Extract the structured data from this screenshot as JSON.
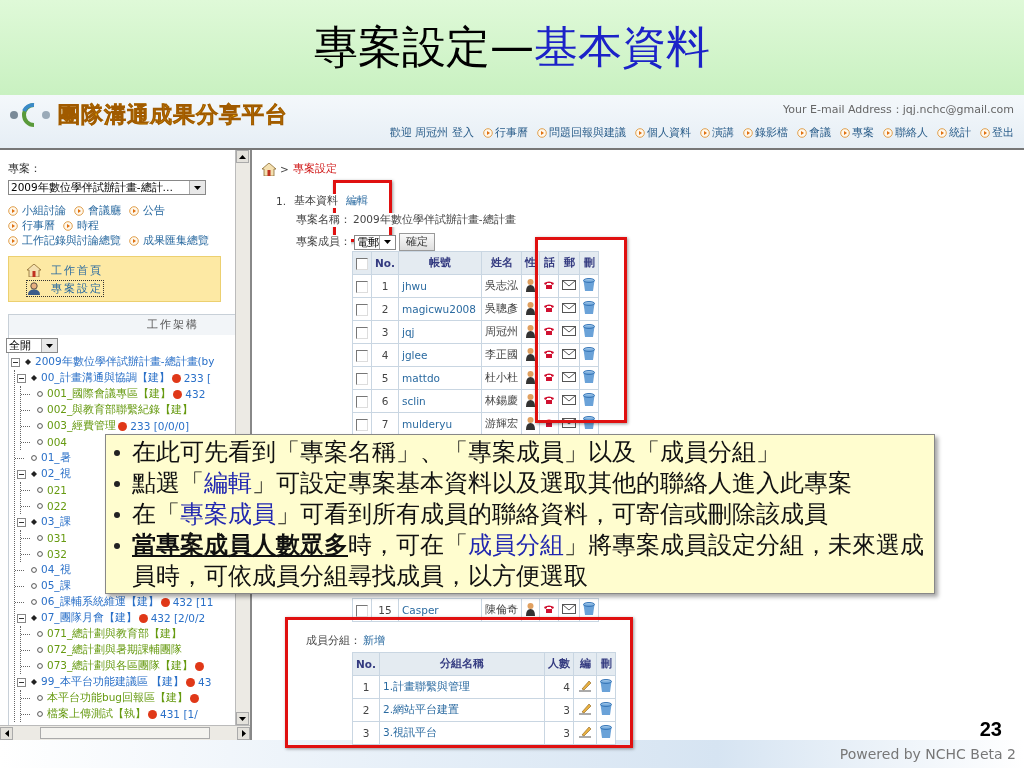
{
  "slide": {
    "title": "專案設定—",
    "title_accent": "基本資料",
    "page_number": "23",
    "footer": "Powered by NCHC Beta 2"
  },
  "header": {
    "logo_text": "團隊溝通成果分享平台",
    "email": "Your E-mail Address：jqj.nchc@gmail.com",
    "welcome": "歡迎 周冠州 登入",
    "nav": [
      "行事曆",
      "問題回報與建議",
      "個人資料",
      "演講",
      "錄影檔",
      "會議",
      "專案",
      "聯絡人",
      "統計",
      "登出"
    ]
  },
  "sidebar": {
    "project_label": "專案：",
    "project_select": "2009年數位學伴試辦計畫-總計…",
    "link_rows": [
      [
        "小組討論",
        "會議廳",
        "公告"
      ],
      [
        "行事曆",
        "時程"
      ],
      [
        "工作記錄與討論總覽",
        "成果匯集總覽"
      ]
    ],
    "menu": [
      {
        "label": "工作首頁",
        "kind": "home",
        "selected": false
      },
      {
        "label": "專案設定",
        "kind": "settings",
        "selected": true
      }
    ],
    "tree_title": "工作架構",
    "tree_filter": "全開",
    "tree": [
      {
        "label": "2009年數位學伴試辦計畫-總計畫(by",
        "dot": false,
        "children": [
          {
            "label": "00_計畫溝通與協調【建】",
            "dot": true,
            "info": "233 [",
            "children": [
              {
                "label": "001_國際會議專區【建】",
                "dot": true,
                "info": "432"
              },
              {
                "label": "002_與教育部聯繫紀錄【建】",
                "dot": false
              },
              {
                "label": "003_經費管理",
                "dot": true,
                "info": "233 [0/0/0]"
              },
              {
                "label": "004",
                "dot": false
              }
            ]
          },
          {
            "label": "01_暑",
            "dot": false
          },
          {
            "label": "02_視",
            "dot": false,
            "children": [
              {
                "label": "021",
                "dot": false
              },
              {
                "label": "022",
                "dot": false
              }
            ]
          },
          {
            "label": "03_課",
            "dot": false,
            "children": [
              {
                "label": "031",
                "dot": false
              },
              {
                "label": "032",
                "dot": false
              }
            ]
          },
          {
            "label": "04_視",
            "dot": false
          },
          {
            "label": "05_課",
            "dot": false
          },
          {
            "label": "06_課輔系統維運【建】",
            "dot": true,
            "info": "432 [11"
          },
          {
            "label": "07_團隊月會【建】",
            "dot": true,
            "info": "432 [2/0/2",
            "children": [
              {
                "label": "071_總計劃與教育部【建】",
                "dot": false
              },
              {
                "label": "072_總計劃與暑期課輔團隊",
                "dot": false
              },
              {
                "label": "073_總計劃與各區團隊【建】",
                "dot": true
              }
            ]
          },
          {
            "label": "99_本平台功能建議區 【建】",
            "dot": true,
            "info": "43",
            "children": [
              {
                "label": "本平台功能bug回報區【建】",
                "dot": true
              },
              {
                "label": "檔案上傳測試【執】",
                "dot": true,
                "info": "431 [1/"
              }
            ]
          }
        ]
      }
    ]
  },
  "main": {
    "breadcrumb_separator": ">",
    "breadcrumb_current": "專案設定",
    "section_number": "1.",
    "section_title": "基本資料",
    "edit_link": "編輯",
    "project_name_label": "專案名稱：",
    "project_name": "2009年數位學伴試辦計畫-總計畫",
    "members_label": "專案成員：",
    "members_select": "電郵",
    "confirm_button": "確定",
    "members": {
      "select_all_checked": false,
      "columns": [
        "No.",
        "帳號",
        "姓名",
        "性",
        "話",
        "郵",
        "刪"
      ],
      "rows": [
        {
          "checked": false,
          "no": "1",
          "account": "jhwu",
          "name": "吳志泓"
        },
        {
          "checked": false,
          "no": "2",
          "account": "magicwu2008",
          "name": "吳聰彥"
        },
        {
          "checked": false,
          "no": "3",
          "account": "jqj",
          "name": "周冠州"
        },
        {
          "checked": false,
          "no": "4",
          "account": "jglee",
          "name": "李正國"
        },
        {
          "checked": false,
          "no": "5",
          "account": "mattdo",
          "name": "杜小杜"
        },
        {
          "checked": false,
          "no": "6",
          "account": "sclin",
          "name": "林錫慶"
        },
        {
          "checked": false,
          "no": "7",
          "account": "mulderyu",
          "name": "游輝宏"
        }
      ],
      "rows_below_note": [
        {
          "checked": false,
          "no": "15",
          "account": "Casper",
          "name": "陳倫奇"
        }
      ]
    },
    "groups_label": "成員分組：",
    "groups_add_link": "新增",
    "groups": {
      "columns": [
        "No.",
        "分組名稱",
        "人數",
        "編",
        "刪"
      ],
      "rows": [
        {
          "no": "1",
          "name": "1.計畫聯繫與管理",
          "count": "4"
        },
        {
          "no": "2",
          "name": "2.網站平台建置",
          "count": "3"
        },
        {
          "no": "3",
          "name": "3.視訊平台",
          "count": "3"
        }
      ]
    }
  },
  "note": {
    "bullets": [
      [
        {
          "text": "在此可先看到「專案名稱」、「專案成員」以及「成員分組」",
          "kind": "plain"
        }
      ],
      [
        {
          "text": "點選「",
          "kind": "plain"
        },
        {
          "text": "編輯",
          "kind": "link"
        },
        {
          "text": "」可設定專案基本資料以及選取其他的聯絡人進入此專案",
          "kind": "plain"
        }
      ],
      [
        {
          "text": "在「",
          "kind": "plain"
        },
        {
          "text": "專案成員",
          "kind": "link"
        },
        {
          "text": "」可看到所有成員的聯絡資料，可寄信或刪除該成員",
          "kind": "plain"
        }
      ],
      [
        {
          "text": "當專案成員人數眾多",
          "kind": "emphasis"
        },
        {
          "text": "時，可在「",
          "kind": "plain"
        },
        {
          "text": "成員分組",
          "kind": "link"
        },
        {
          "text": "」將專案成員設定分組，未來選成員時，可依成員分組尋找成員，以方便選取",
          "kind": "plain"
        }
      ]
    ]
  }
}
